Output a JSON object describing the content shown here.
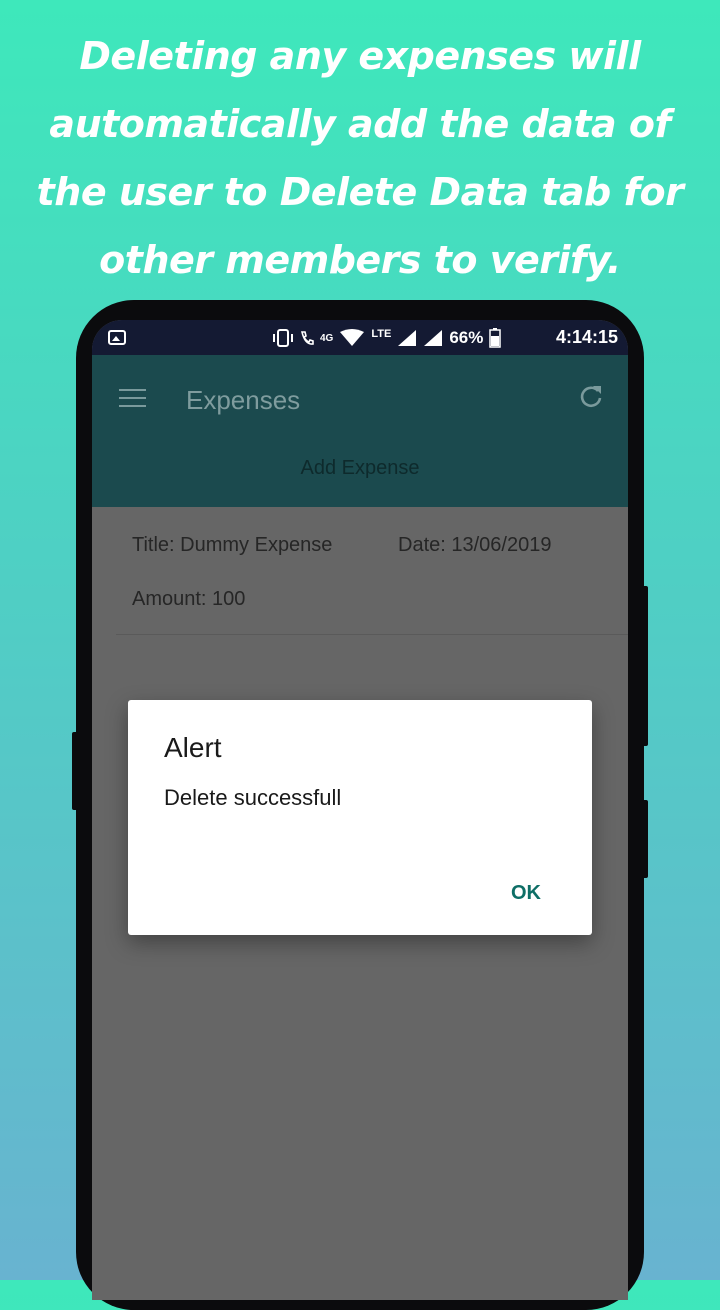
{
  "promo": {
    "lines": [
      "Deleting any expenses will",
      "automatically add the data of",
      "the user to Delete Data tab for",
      "other members to verify."
    ]
  },
  "status_bar": {
    "network_4g": "4G",
    "network_lte": "LTE",
    "battery": "66%",
    "time": "4:14:15",
    "icons": [
      "gallery-icon",
      "vibrate-icon",
      "call-icon",
      "wifi-icon",
      "signal-icon",
      "battery-icon"
    ]
  },
  "app_bar": {
    "title": "Expenses",
    "add_expense_label": "Add Expense",
    "icons": [
      "menu-icon",
      "refresh-icon"
    ]
  },
  "expense_item": {
    "title": "Title: Dummy Expense",
    "date": "Date: 13/06/2019",
    "amount": "Amount: 100"
  },
  "dialog": {
    "title": "Alert",
    "message": "Delete successfull",
    "ok_label": "OK"
  },
  "colors": {
    "app_bar": "#1b4a4e",
    "accent": "#0e6e66",
    "status_bar": "#141a33",
    "scrim": "#666666"
  }
}
